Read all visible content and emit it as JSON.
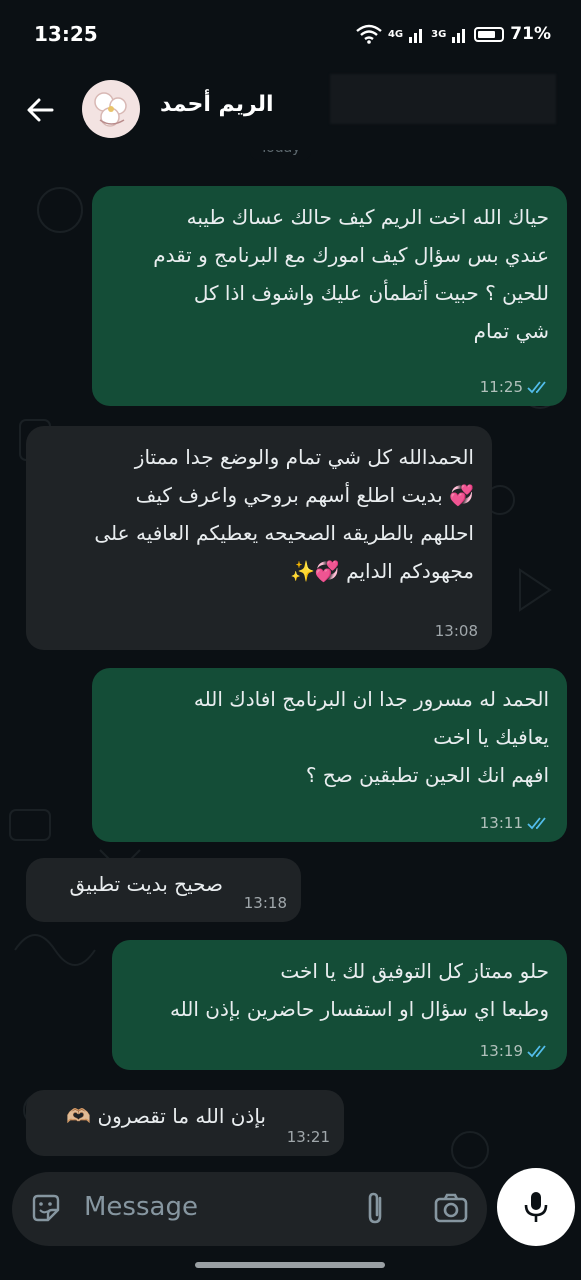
{
  "status": {
    "time": "13:25",
    "net1": "4G",
    "net2": "3G",
    "battery": "71%"
  },
  "header": {
    "contact_name": "الريم أحمد"
  },
  "chat": {
    "day_label": "Today",
    "messages": [
      {
        "dir": "out",
        "text": "حياك الله اخت الريم كيف حالك عساك طيبه\nعندي بس سؤال كيف امورك مع البرنامج و تقدم\nللحين ؟ حبيت أتطمأن عليك واشوف اذا كل\nشي تمام",
        "time": "11:25",
        "read": true
      },
      {
        "dir": "in",
        "text": "الحمدالله كل شي تمام والوضع جدا ممتاز\n💞 بديت اطلع أسهم بروحي واعرف كيف\nاحللهم بالطريقه الصحيحه يعطيكم العافيه على\nمجهودكم الدايم 💞✨",
        "time": "13:08"
      },
      {
        "dir": "out",
        "text": "الحمد له مسرور جدا ان البرنامج افادك الله\nيعافيك يا اخت\nافهم انك الحين تطبقين صح ؟",
        "time": "13:11",
        "read": true
      },
      {
        "dir": "in",
        "text": "صحيح بديت تطبيق",
        "time": "13:18"
      },
      {
        "dir": "out",
        "text": "حلو ممتاز كل التوفيق لك يا اخت\nوطبعا اي سؤال او استفسار حاضرين بإذن الله",
        "time": "13:19",
        "read": true
      },
      {
        "dir": "in",
        "text": "بإذن الله ما تقصرون 🫶🏼",
        "time": "13:21"
      }
    ]
  },
  "composer": {
    "placeholder": "Message"
  },
  "colors": {
    "outgoing": "#144d37",
    "incoming": "#1f2326",
    "read_tick": "#53bdeb"
  }
}
